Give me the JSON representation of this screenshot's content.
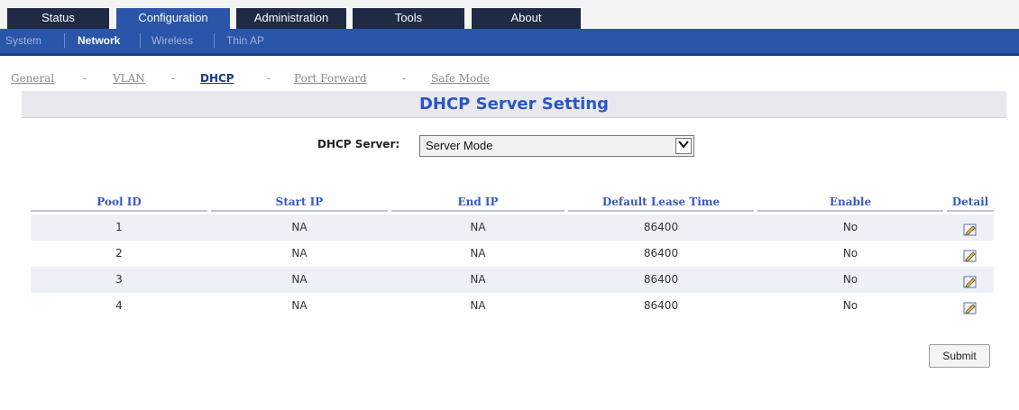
{
  "top_tabs": [
    "Status",
    "Configuration",
    "Administration",
    "Tools",
    "About"
  ],
  "sub_nav": [
    "System",
    "Network",
    "Wireless",
    "Thin AP"
  ],
  "breadcrumb": {
    "items": [
      "General",
      "VLAN",
      "DHCP",
      "Port Forward",
      "Safe Mode"
    ],
    "separator": "-"
  },
  "section_title": "DHCP Server Setting",
  "dhcp_server": {
    "label": "DHCP Server:",
    "value": "Server Mode"
  },
  "table": {
    "headers": [
      "Pool ID",
      "Start IP",
      "End IP",
      "Default Lease Time",
      "Enable",
      "Detail"
    ],
    "rows": [
      {
        "pool_id": "1",
        "start_ip": "NA",
        "end_ip": "NA",
        "lease": "86400",
        "enable": "No"
      },
      {
        "pool_id": "2",
        "start_ip": "NA",
        "end_ip": "NA",
        "lease": "86400",
        "enable": "No"
      },
      {
        "pool_id": "3",
        "start_ip": "NA",
        "end_ip": "NA",
        "lease": "86400",
        "enable": "No"
      },
      {
        "pool_id": "4",
        "start_ip": "NA",
        "end_ip": "NA",
        "lease": "86400",
        "enable": "No"
      }
    ]
  },
  "submit_label": "Submit",
  "icons": {
    "detail": "edit-icon",
    "dropdown": "chevron-down-icon"
  },
  "colors": {
    "nav_dark": "#1f2a44",
    "nav_active": "#2b55a8",
    "title_blue": "#2a56c6"
  }
}
